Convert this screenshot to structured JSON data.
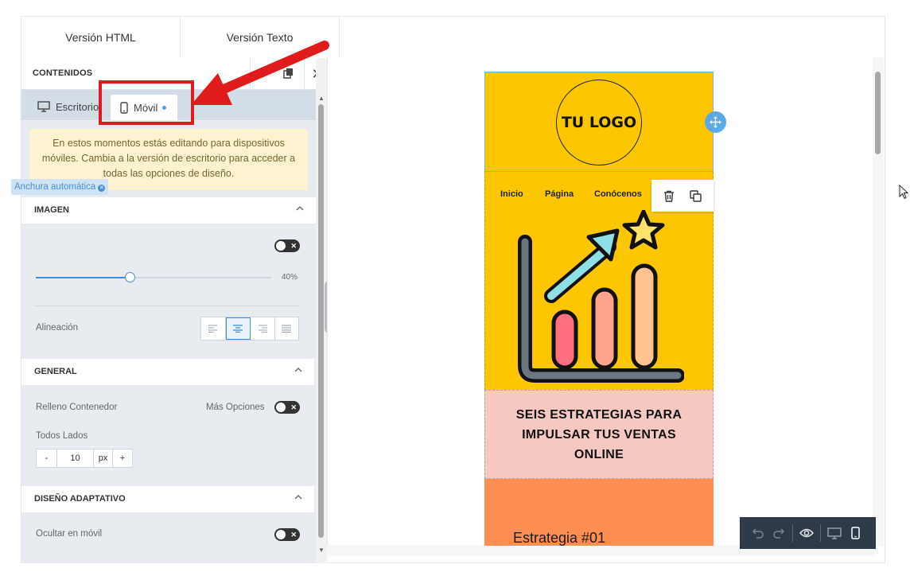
{
  "tabs": {
    "html": "Versión HTML",
    "text": "Versión Texto"
  },
  "panel": {
    "title": "CONTENIDOS",
    "device_desktop": "Escritorio",
    "device_mobile": "Móvil",
    "notice": "En estos momentos estás editando para dispositivos móviles. Cambia a la versión de escritorio para acceder a todas las opciones de diseño."
  },
  "imagen": {
    "header": "IMAGEN",
    "auto_width_chip": "Anchura automática",
    "slider_value": "40%",
    "slider_fraction": 0.4,
    "align_label": "Alineación"
  },
  "general": {
    "header": "GENERAL",
    "padding_label": "Relleno Contenedor",
    "more_options": "Más Opciones",
    "all_sides": "Todos Lados",
    "stepper_minus": "-",
    "stepper_value": "10",
    "stepper_unit": "px",
    "stepper_plus": "+"
  },
  "responsive": {
    "header": "DISEÑO ADAPTATIVO",
    "hide_mobile": "Ocultar en móvil"
  },
  "email": {
    "logo": "TU LOGO",
    "nav": [
      "Inicio",
      "Página",
      "Conócenos"
    ],
    "headline": "SEIS ESTRATEGIAS PARA IMPULSAR TUS VENTAS ONLINE",
    "strategy": "Estrategia #01",
    "colors": {
      "yellow": "#fdc700",
      "pink": "#f6c8c2",
      "orange": "#fd8f52"
    }
  },
  "accent": "#3b8ee0",
  "highlight": "#e01b1b"
}
